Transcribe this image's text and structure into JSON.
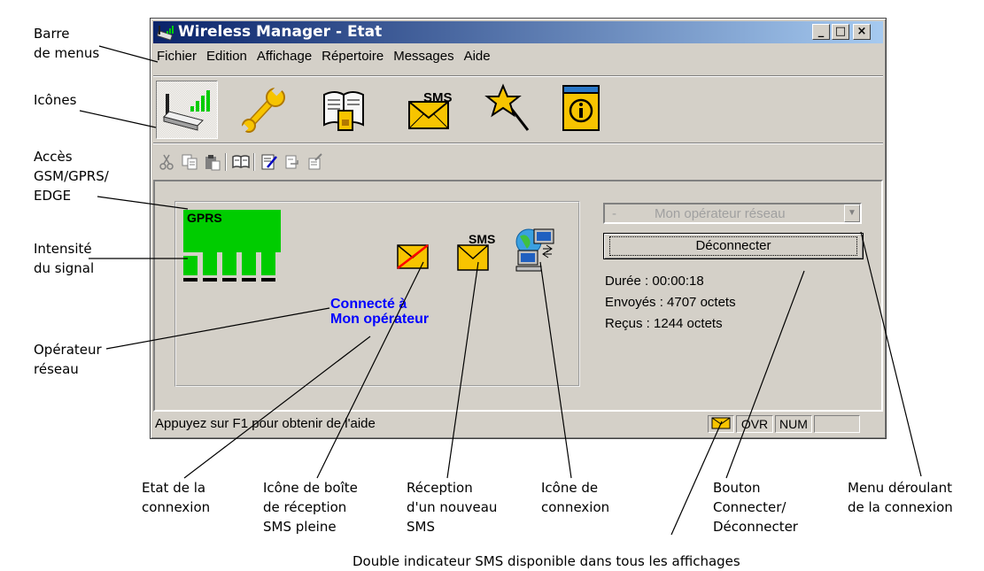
{
  "window": {
    "title": "Wireless Manager - Etat",
    "controls": [
      "_",
      "□",
      "×"
    ]
  },
  "menu": [
    "Fichier",
    "Edition",
    "Affichage",
    "Répertoire",
    "Messages",
    "Aide"
  ],
  "toolbar_big": [
    {
      "icon": "modem-signal-icon"
    },
    {
      "icon": "wrench-icon"
    },
    {
      "icon": "phonebook-icon"
    },
    {
      "icon": "sms-envelope-icon",
      "label": "SMS"
    },
    {
      "icon": "magic-wand-icon"
    },
    {
      "icon": "info-icon"
    }
  ],
  "toolbar_small": [
    "cut-icon",
    "copy-icon",
    "paste-icon",
    "book-icon",
    "new-message-icon",
    "send-icon",
    "receive-icon"
  ],
  "status_panel": {
    "access": "GPRS",
    "signal_level": 5,
    "signal_max": 5,
    "connection_state": [
      "Connecté à",
      "Mon opérateur"
    ],
    "sms_badge": "SMS"
  },
  "right_panel": {
    "combo_selection": "-",
    "combo_value": "Mon opérateur réseau",
    "button": "Déconnecter",
    "duration": "Durée : 00:00:18",
    "sent": "Envoyés : 4707  octets",
    "received": "Reçus : 1244 octets"
  },
  "statusbar": {
    "text": "Appuyez sur F1 pour obtenir de l'aide",
    "panels": [
      "OVR",
      "NUM",
      ""
    ]
  },
  "annotations": {
    "barre": [
      "Barre",
      "de menus"
    ],
    "icones": "Icônes",
    "acces": [
      "Accès",
      "GSM/GPRS/",
      "EDGE"
    ],
    "intensite": [
      "Intensité",
      "du signal"
    ],
    "operateur": [
      "Opérateur",
      "réseau"
    ],
    "etat": [
      "Etat de la",
      "connexion"
    ],
    "boite": [
      "Icône de boîte",
      "de réception",
      "SMS pleine"
    ],
    "reception": [
      "Réception",
      "d'un nouveau",
      "SMS"
    ],
    "icone_connexion": [
      "Icône de",
      "connexion"
    ],
    "bouton": [
      "Bouton",
      "Connecter/",
      "Déconnecter"
    ],
    "menu_deroulant": [
      "Menu déroulant",
      "de la connexion"
    ],
    "double": "Double indicateur SMS disponible dans tous les affichages"
  },
  "colors": {
    "titlebar_start": "#0a246a",
    "signal_green": "#00cc00",
    "status_text_blue": "#0000ff",
    "envelope_yellow": "#f7c400"
  }
}
